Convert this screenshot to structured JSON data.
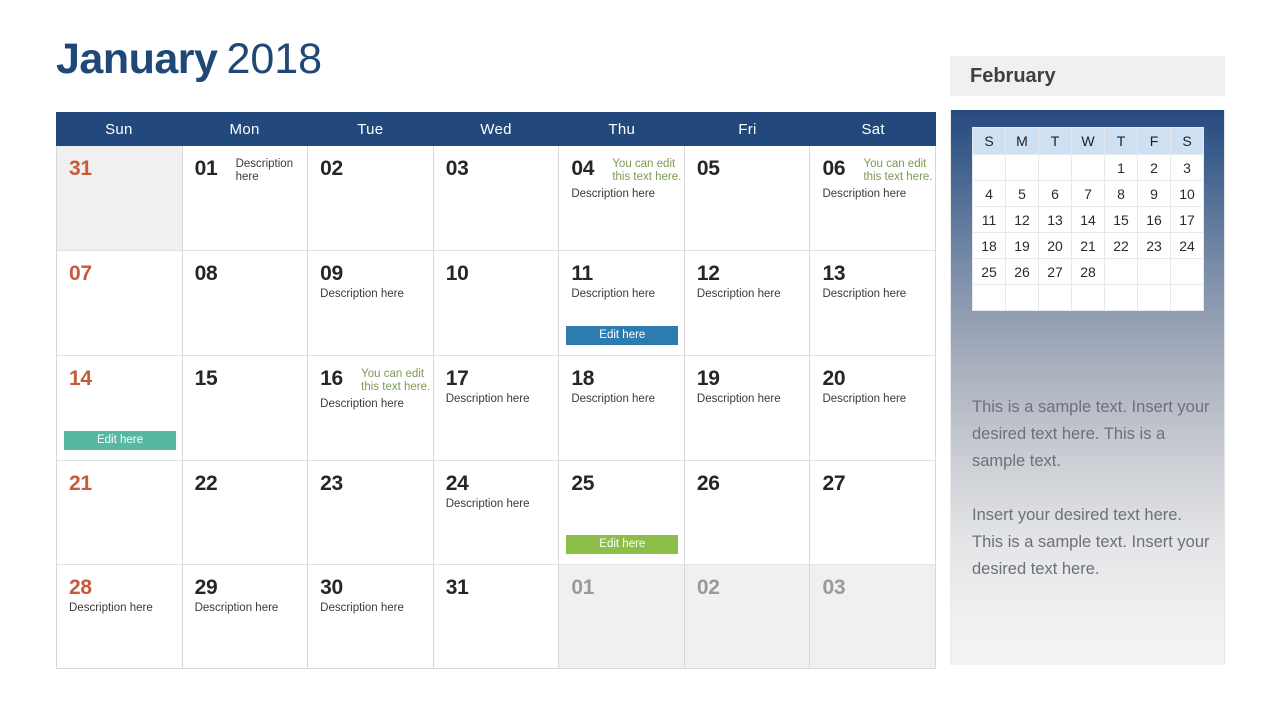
{
  "title": {
    "month": "January",
    "year": "2018"
  },
  "colors": {
    "header_bar": "#22487C",
    "title": "#1F4876",
    "sunday": "#C85A3C",
    "muted": "#9A9A9A",
    "note_green": "#7C9A54",
    "button_blue": "#2E7CAF",
    "button_teal": "#56B8A0",
    "button_green": "#8CBF49",
    "mini_header": "#CFE0F2"
  },
  "calendar": {
    "weekdays": [
      "Sun",
      "Mon",
      "Tue",
      "Wed",
      "Thu",
      "Fri",
      "Sat"
    ],
    "weeks": [
      [
        {
          "num": "31",
          "muted": true,
          "sunday": true
        },
        {
          "num": "01",
          "note": null,
          "desc_inline": "Description here"
        },
        {
          "num": "02"
        },
        {
          "num": "03"
        },
        {
          "num": "04",
          "note": "You can edit this text here.",
          "desc": "Description here"
        },
        {
          "num": "05"
        },
        {
          "num": "06",
          "note": "You can edit this text here.",
          "desc": "Description here"
        }
      ],
      [
        {
          "num": "07",
          "sunday": true
        },
        {
          "num": "08"
        },
        {
          "num": "09",
          "desc": "Description here"
        },
        {
          "num": "10"
        },
        {
          "num": "11",
          "desc": "Description here",
          "button": "Edit here",
          "button_color": "blue"
        },
        {
          "num": "12",
          "desc": "Description here"
        },
        {
          "num": "13",
          "desc": "Description here"
        }
      ],
      [
        {
          "num": "14",
          "sunday": true,
          "button": "Edit here",
          "button_color": "teal"
        },
        {
          "num": "15"
        },
        {
          "num": "16",
          "note": "You can edit this text here.",
          "desc": "Description here"
        },
        {
          "num": "17",
          "desc": "Description here"
        },
        {
          "num": "18",
          "desc": "Description here"
        },
        {
          "num": "19",
          "desc": "Description here"
        },
        {
          "num": "20",
          "desc": "Description here"
        }
      ],
      [
        {
          "num": "21",
          "sunday": true
        },
        {
          "num": "22"
        },
        {
          "num": "23"
        },
        {
          "num": "24",
          "desc": "Description here"
        },
        {
          "num": "25",
          "button": "Edit here",
          "button_color": "green"
        },
        {
          "num": "26"
        },
        {
          "num": "27"
        }
      ],
      [
        {
          "num": "28",
          "sunday": true,
          "desc": "Description here"
        },
        {
          "num": "29",
          "desc": "Description here"
        },
        {
          "num": "30",
          "desc": "Description here"
        },
        {
          "num": "31"
        },
        {
          "num": "01",
          "muted": true
        },
        {
          "num": "02",
          "muted": true
        },
        {
          "num": "03",
          "muted": true
        }
      ]
    ]
  },
  "sidebar": {
    "title": "February",
    "mini_calendar": {
      "weekdays": [
        "S",
        "M",
        "T",
        "W",
        "T",
        "F",
        "S"
      ],
      "weeks": [
        [
          "",
          "",
          "",
          "",
          "1",
          "2",
          "3"
        ],
        [
          "4",
          "5",
          "6",
          "7",
          "8",
          "9",
          "10"
        ],
        [
          "11",
          "12",
          "13",
          "14",
          "15",
          "16",
          "17"
        ],
        [
          "18",
          "19",
          "20",
          "21",
          "22",
          "23",
          "24"
        ],
        [
          "25",
          "26",
          "27",
          "28",
          "",
          "",
          ""
        ],
        [
          "",
          "",
          "",
          "",
          "",
          "",
          ""
        ]
      ]
    },
    "paragraphs": [
      "This is a sample text. Insert your desired text here. This is a sample text.",
      "Insert your desired text here. This is a sample text. Insert your desired text here."
    ]
  }
}
